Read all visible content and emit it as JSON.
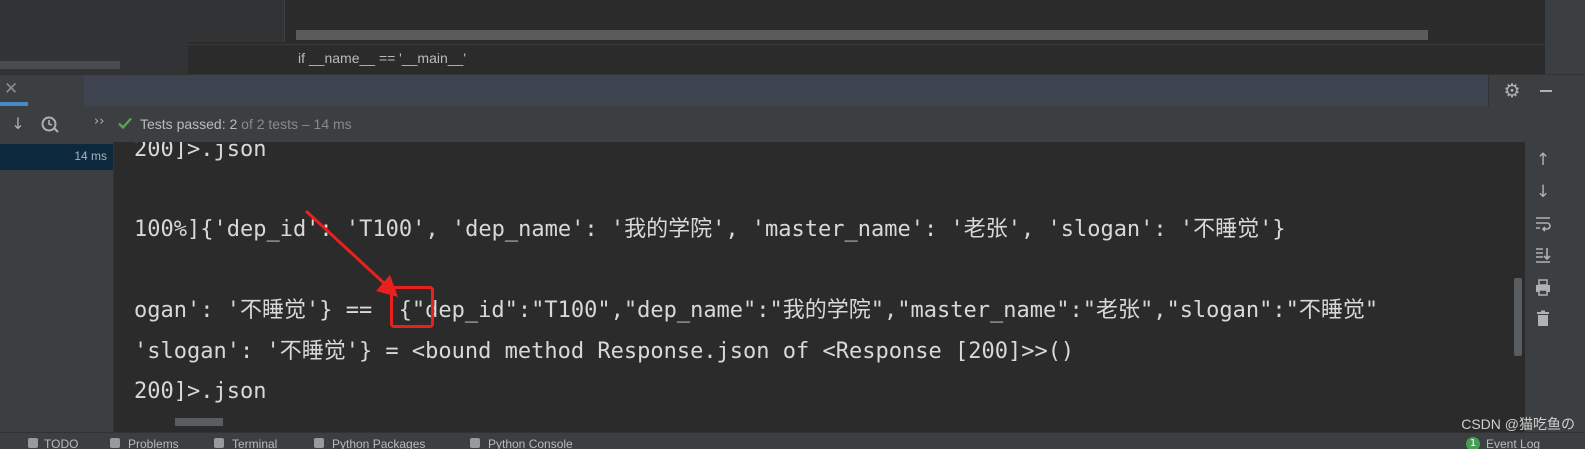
{
  "editor": {
    "breadcrumb": "if __name__ == '__main__'"
  },
  "tool_window": {
    "close_glyph": "✕",
    "settings_icon": "gear-icon",
    "minimize_icon": "minimize-icon"
  },
  "toolbar": {
    "status_passed": "Tests passed: 2",
    "status_of": " of 2 tests – 14 ms",
    "chevrons": "››",
    "accent_color": "#5aa05a"
  },
  "test_tree": {
    "selected_time": "14 ms",
    "selected_bg": "#0d293e"
  },
  "console": {
    "lines": [
      "200]>.json",
      "",
      "100%]{'dep_id': 'T100', 'dep_name': '我的学院', 'master_name': '老张', 'slogan': '不睡觉'}",
      "",
      "ogan': '不睡觉'} == '{\"dep_id\":\"T100\",\"dep_name\":\"我的学院\",\"master_name\":\"老张\",\"slogan\":\"不睡觉\"",
      "'slogan': '不睡觉'} = <bound method Response.json of <Response [200]>>()",
      "200]>.json"
    ],
    "text_color": "#d8d8d8"
  },
  "annotation": {
    "color": "#e8211e"
  },
  "bottom_bar": {
    "items": [
      "TODO",
      "Problems",
      "Terminal",
      "Python Packages",
      "Python Console"
    ],
    "right_badge": "1",
    "right_label": "Event Log"
  },
  "watermark": "CSDN @猫吃鱼の"
}
